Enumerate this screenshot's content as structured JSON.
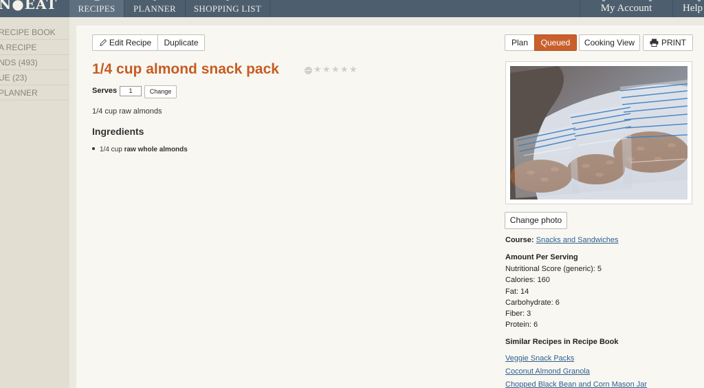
{
  "nav": {
    "logo": "N●EAT",
    "tabs": [
      {
        "label": "RECIPES"
      },
      {
        "label": "PLANNER"
      },
      {
        "label": "SHOPPING LIST"
      }
    ],
    "account": "My Account",
    "help": "Help"
  },
  "sidebar": {
    "items": [
      {
        "label": "RECIPE BOOK"
      },
      {
        "label": "A RECIPE"
      },
      {
        "label": "NDS (493)"
      },
      {
        "label": "UE (23)"
      },
      {
        "label": "PLANNER"
      }
    ]
  },
  "toolbar": {
    "edit_label": "Edit Recipe",
    "duplicate_label": "Duplicate",
    "plan_label": "Plan",
    "queued_label": "Queued",
    "cooking_view_label": "Cooking View",
    "print_label": "PRINT"
  },
  "recipe": {
    "title": "1/4 cup almond snack pack",
    "rating": 0,
    "serves_label": "Serves",
    "serves_value": "1",
    "change_label": "Change",
    "description": "1/4 cup raw almonds",
    "ingredients_heading": "Ingredients",
    "ingredients": [
      {
        "amount": "1/4 cup",
        "name": "raw whole almonds"
      }
    ]
  },
  "photo": {
    "change_label": "Change photo"
  },
  "course": {
    "label": "Course:",
    "value": "Snacks and Sandwiches"
  },
  "nutrition": {
    "heading": "Amount Per Serving",
    "rows": [
      {
        "text": "Nutritional Score (generic): 5"
      },
      {
        "text": "Calories: 160"
      },
      {
        "text": "Fat: 14"
      },
      {
        "text": "Carbohydrate: 6"
      },
      {
        "text": "Fiber: 3"
      },
      {
        "text": "Protein: 6"
      }
    ]
  },
  "similar": {
    "heading": "Similar Recipes in Recipe Book",
    "links": [
      {
        "label": "Veggie Snack Packs"
      },
      {
        "label": "Coconut Almond Granola"
      },
      {
        "label": "Chopped Black Bean and Corn Mason Jar"
      }
    ]
  },
  "colors": {
    "accent": "#c75c22",
    "nav_bg": "#4d5f6f",
    "link": "#2e5f8d"
  }
}
